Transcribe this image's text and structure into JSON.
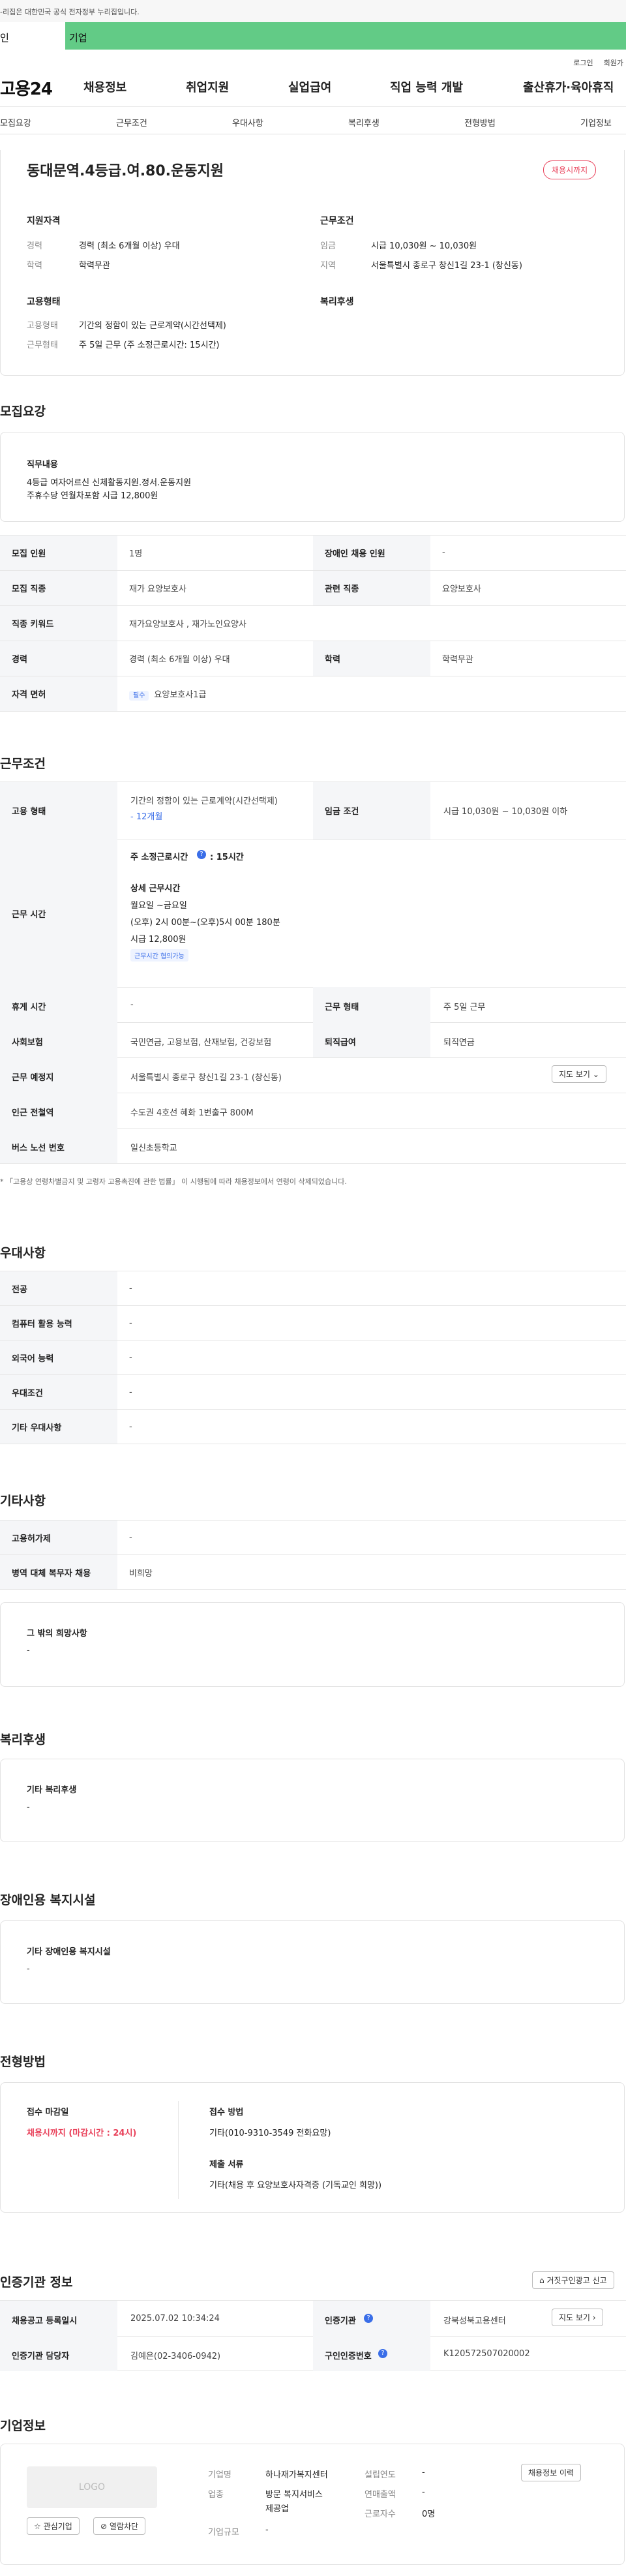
{
  "gov_banner": "-리집은 대한민국 공식 전자정부 누리집입니다.",
  "mode_tabs": [
    "인",
    "기업"
  ],
  "util_links": [
    "로그인",
    "회원가"
  ],
  "logo": "고용24",
  "main_nav": [
    "채용정보",
    "취업지원",
    "실업급여",
    "직업 능력 개발",
    "출산휴가·육아휴직"
  ],
  "sub_nav": [
    "모집요강",
    "근무조건",
    "우대사항",
    "복리후생",
    "전형방법",
    "기업정보"
  ],
  "job_title": "동대문역.4등급.여.80.운동지원",
  "deadline_badge": "채용시까지",
  "summary": {
    "qual_title": "지원자격",
    "career_label": "경력",
    "career_value": "경력 (최소 6개월 이상) 우대",
    "edu_label": "학력",
    "edu_value": "학력무관",
    "emp_title": "고용형태",
    "emptype_label": "고용형태",
    "emptype_value": "기간의 정함이 있는 근로계약(시간선택제)",
    "worktime_label": "근무형태",
    "worktime_value": "주 5일 근무 (주 소정근로시간: 15시간)",
    "cond_title": "근무조건",
    "wage_label": "임금",
    "wage_value": "시급 10,030원 ~ 10,030원",
    "region_label": "지역",
    "region_value": "서울특별시 종로구 창신1길 23-1 (창신동)",
    "welfare_title": "복리후생"
  },
  "recruit": {
    "title": "모집요강",
    "duty_label": "직무내용",
    "duty_line1": "4등급 여자어르신 신체활동지원.정서.운동지원",
    "duty_line2": "주휴수당 연월차포함 시급 12,800원",
    "rows": [
      [
        "모집 인원",
        "1명",
        "장애인 채용 인원",
        "-"
      ],
      [
        "모집 직종",
        "재가 요양보호사",
        "관련 직종",
        "요양보호사"
      ],
      [
        "직종 키워드",
        "재가요양보호사 , 재가노인요양사",
        "",
        ""
      ],
      [
        "경력",
        "경력 (최소 6개월 이상) 우대",
        "학력",
        "학력무관"
      ]
    ],
    "license_label": "자격 면허",
    "license_tag": "필수",
    "license_value": "요양보호사1급"
  },
  "conditions": {
    "title": "근무조건",
    "emp_label": "고용 형태",
    "emp_value": "기간의 정함이 있는 근로계약(시간선택제)",
    "emp_period": "- 12개월",
    "wage_label": "임금 조건",
    "wage_value": "시급 10,030원 ~ 10,030원 이하",
    "time_label": "근무 시간",
    "weekly_hours": "주 소정근로시간",
    "weekly_hours_value": ": 15시간",
    "detail_title": "상세 근무시간",
    "detail_days": "월요일 ~금요일",
    "detail_hours": "(오후) 2시 00분~(오후)5시 00분 180분",
    "detail_wage": "시급 12,800원",
    "detail_tag": "근무시간 협의가능",
    "rows": [
      [
        "휴게 시간",
        "-",
        "근무 형태",
        "주 5일 근무"
      ],
      [
        "사회보험",
        "국민연금, 고용보험, 산재보험, 건강보험",
        "퇴직급여",
        "퇴직연금"
      ]
    ],
    "place_label": "근무 예정지",
    "place_value": "서울특별시 종로구 창신1길 23-1 (창신동)",
    "map_button": "지도 보기",
    "subway_label": "인근 전철역",
    "subway_value": "수도권 4호선 혜화 1번출구 800M",
    "bus_label": "버스 노선 번호",
    "bus_value": "일신초등학교",
    "notice": "「고용상 연령차별금지 및 고령자 고용촉진에 관한 법률」 이 시행됨에 따라 채용정보에서 연령이 삭제되었습니다."
  },
  "preference": {
    "title": "우대사항",
    "rows": [
      [
        "전공",
        "-"
      ],
      [
        "컴퓨터 활용 능력",
        "-"
      ],
      [
        "외국어 능력",
        "-"
      ],
      [
        "우대조건",
        "-"
      ],
      [
        "기타 우대사항",
        "-"
      ]
    ]
  },
  "etc": {
    "title": "기타사항",
    "rows": [
      [
        "고용허가제",
        "-"
      ],
      [
        "병역 대체 복무자 채용",
        "비희망"
      ]
    ],
    "other_title": "그 밖의 희망사항",
    "other_value": "-"
  },
  "welfare": {
    "title": "복리후생",
    "item_title": "기타 복리후생",
    "item_value": "-"
  },
  "disabled": {
    "title": "장애인용 복지시설",
    "item_title": "기타 장애인용 복지시설",
    "item_value": "-"
  },
  "selection": {
    "title": "전형방법",
    "deadline_label": "접수 마감일",
    "deadline_value": "채용시까지 (마감시간 : 24시)",
    "method_label": "접수 방법",
    "method_value": "기타(010-9310-3549 전화요망)",
    "docs_label": "제출 서류",
    "docs_value": "기타(채용 후 요양보호사자격증 (기독교인 희망))"
  },
  "agency": {
    "title": "인증기관 정보",
    "report_button": "거짓구인광고 신고",
    "reg_label": "채용공고 등록일시",
    "reg_value": "2025.07.02 10:34:24",
    "auth_label": "인증기관",
    "auth_value": "강북성북고용센터",
    "map_button": "지도 보기",
    "manager_label": "인증기관 담당자",
    "manager_value": "김예은(02-3406-0942)",
    "jobno_label": "구인인증번호",
    "jobno_value": "K120572507020002"
  },
  "company": {
    "title": "기업정보",
    "logo_text": "LOGO",
    "fav_button": "관심기업",
    "block_button": "열람차단",
    "name_label": "기업명",
    "name_value": "하나재가복지센터",
    "industry_label": "업종",
    "industry_value_1": "방문 복지서비스",
    "industry_value_2": "제공업",
    "size_label": "기업규모",
    "size_value": "-",
    "founded_label": "설립연도",
    "founded_value": "-",
    "revenue_label": "연매출액",
    "revenue_value": "-",
    "employees_label": "근로자수",
    "employees_value": "0명",
    "history_button": "채용정보 이력"
  }
}
